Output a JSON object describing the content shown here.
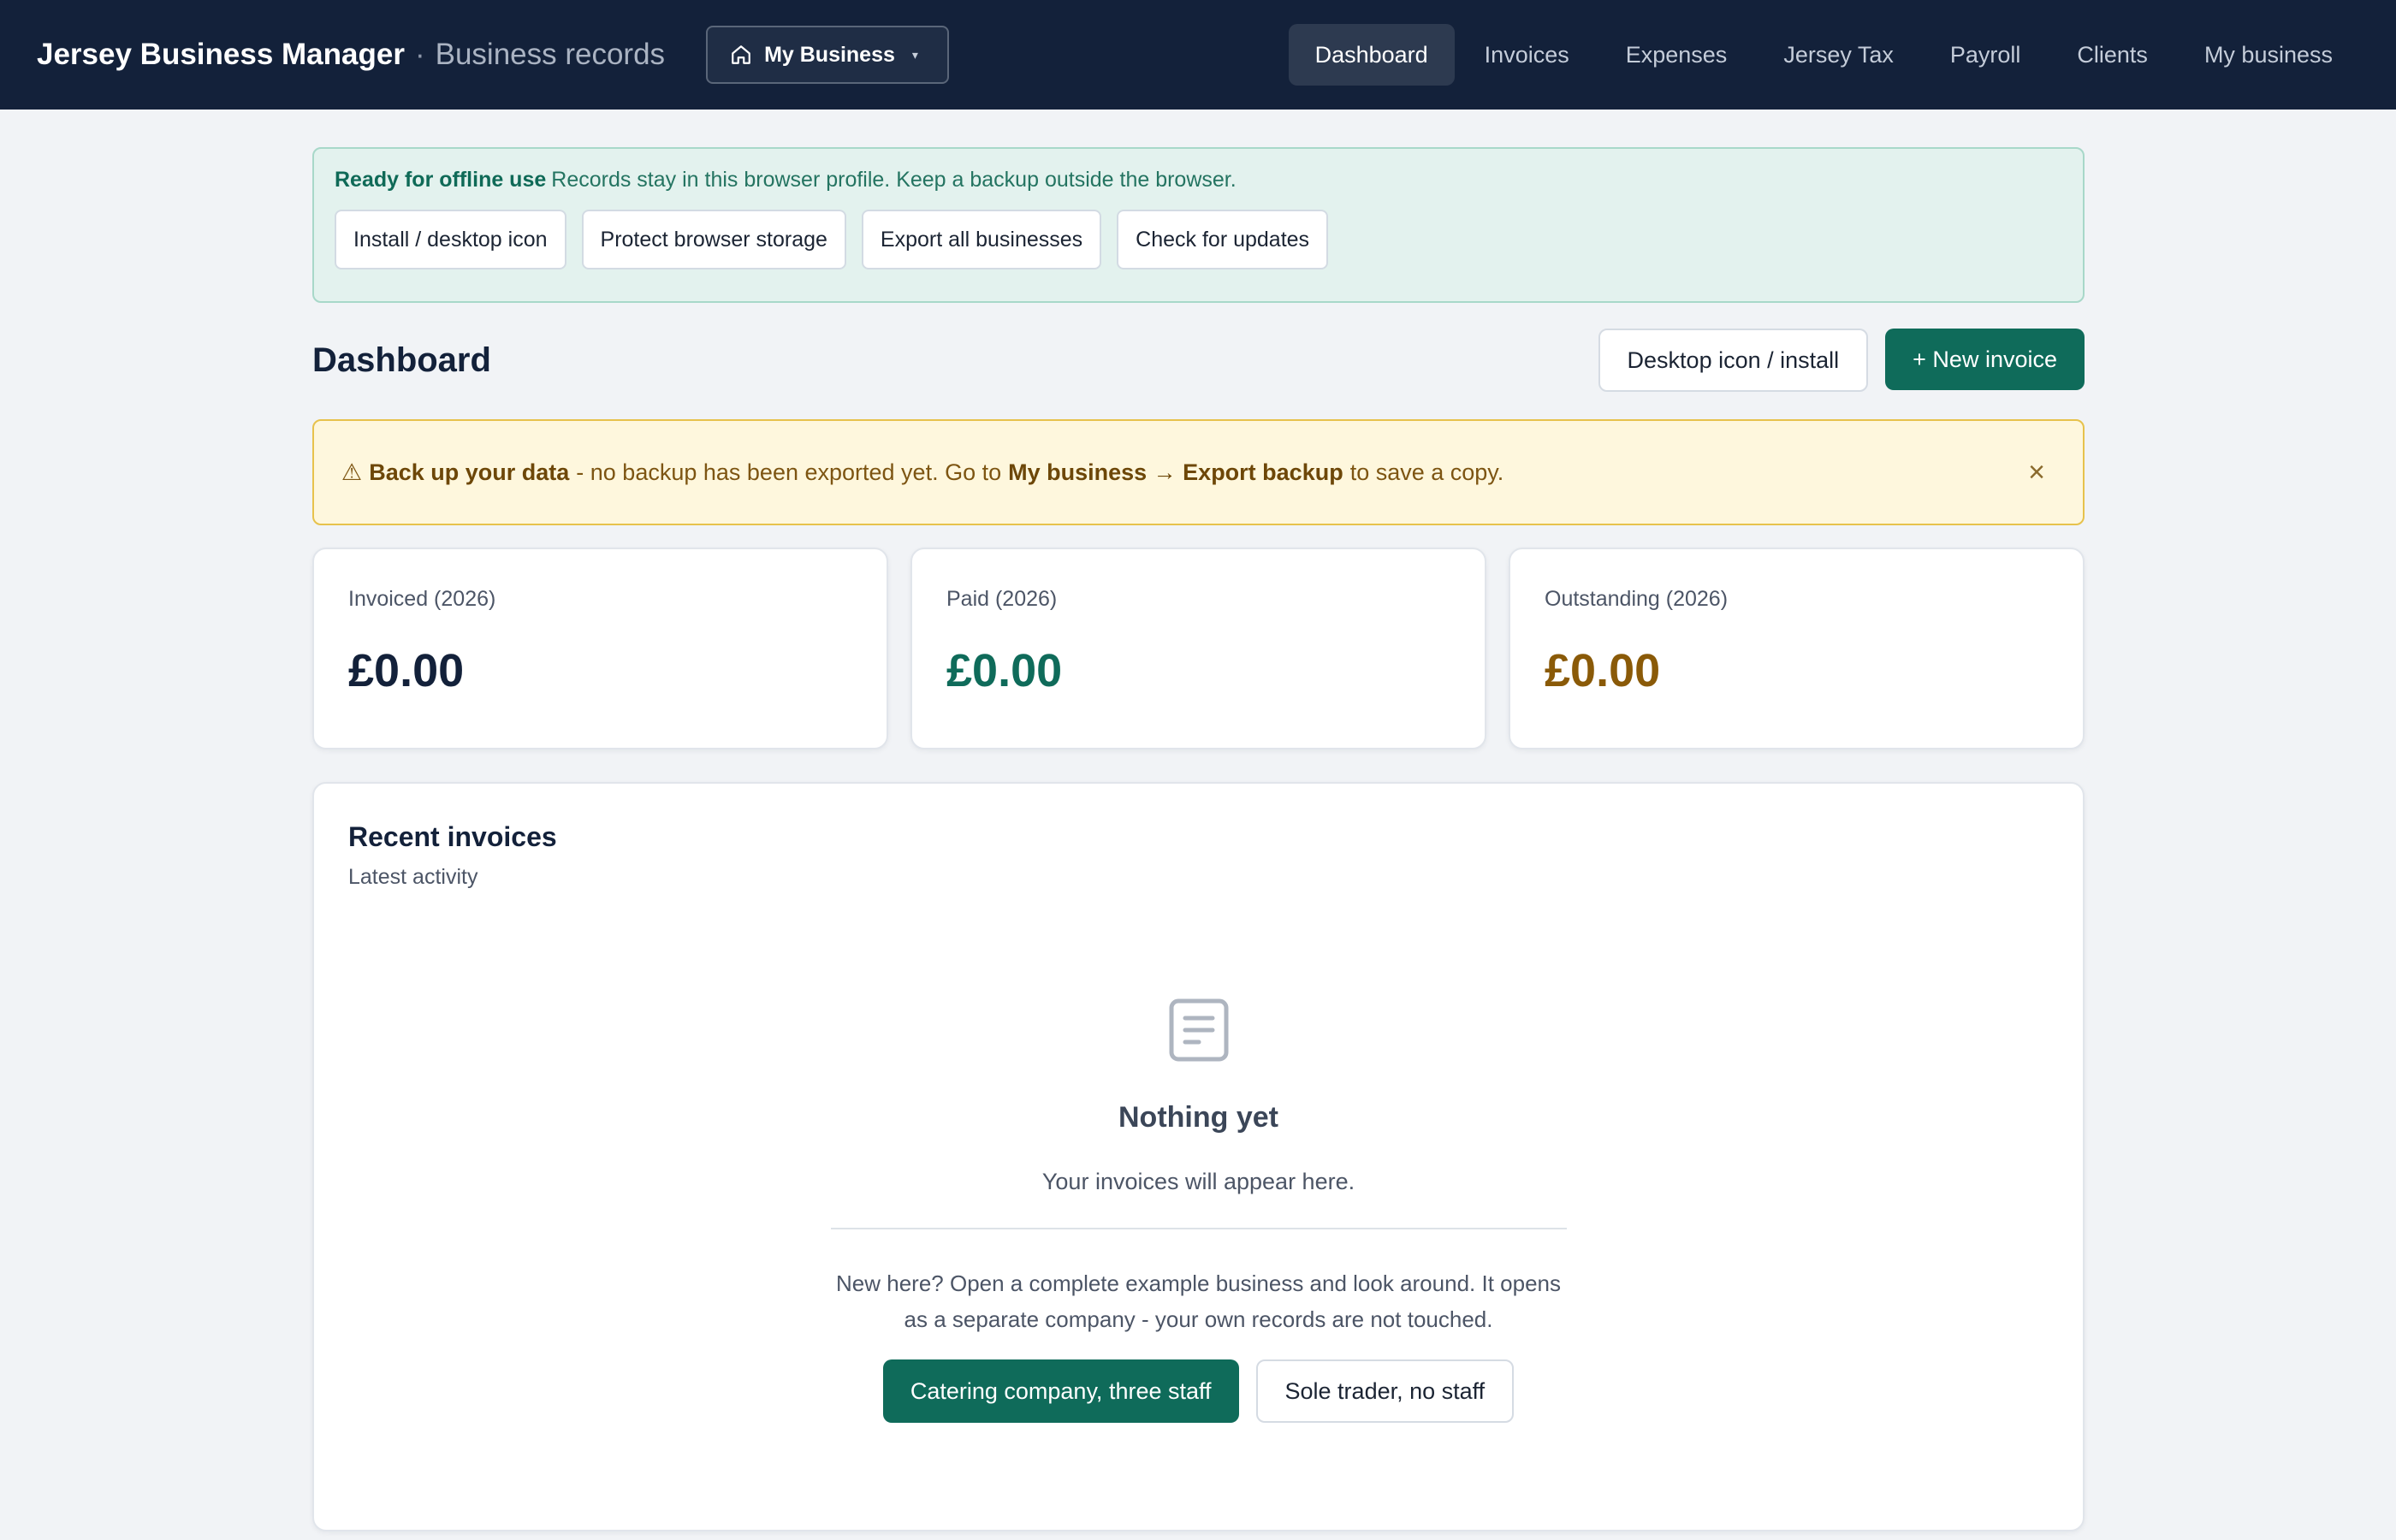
{
  "app": {
    "title": "Jersey Business Manager",
    "separator": "·",
    "subtitle": "Business records"
  },
  "business_switcher": {
    "label": "My Business",
    "icon": "home-icon",
    "caret": "▾"
  },
  "nav": {
    "items": [
      {
        "label": "Dashboard",
        "active": true
      },
      {
        "label": "Invoices"
      },
      {
        "label": "Expenses"
      },
      {
        "label": "Jersey Tax"
      },
      {
        "label": "Payroll"
      },
      {
        "label": "Clients"
      },
      {
        "label": "My business"
      }
    ]
  },
  "offline": {
    "title": "Ready for offline use",
    "message": "Records stay in this browser profile. Keep a backup outside the browser.",
    "actions": [
      "Install / desktop icon",
      "Protect browser storage",
      "Export all businesses",
      "Check for updates"
    ]
  },
  "dashboard": {
    "title": "Dashboard",
    "install_label": "Desktop icon / install",
    "new_invoice_label": "+ New invoice"
  },
  "backup_warning": {
    "icon": "⚠",
    "strong_1": "Back up your data",
    "text_1": "- no backup has been exported yet. Go to",
    "strong_2": "My business → Export backup",
    "text_2": "to save a copy.",
    "close": "×"
  },
  "stats": [
    {
      "label": "Invoiced (2026)",
      "value": "£0.00",
      "color": "#13213a"
    },
    {
      "label": "Paid (2026)",
      "value": "£0.00",
      "color": "#0f6b5a"
    },
    {
      "label": "Outstanding (2026)",
      "value": "£0.00",
      "color": "#8a5a08"
    }
  ],
  "recent": {
    "title": "Recent invoices",
    "subtitle": "Latest activity",
    "empty_icon": "document-icon",
    "empty_title": "Nothing yet",
    "empty_desc": "Your invoices will appear here.",
    "example_note": "New here? Open a complete example business and look around. It opens as a separate company - your own records are not touched.",
    "example_primary": "Catering company, three staff",
    "example_secondary": "Sole trader, no staff"
  },
  "colors": {
    "topbar": "#13213a",
    "accent": "#0f6b5a",
    "warning_bg": "#fef7dd",
    "offline_bg": "#e3f2ee"
  }
}
